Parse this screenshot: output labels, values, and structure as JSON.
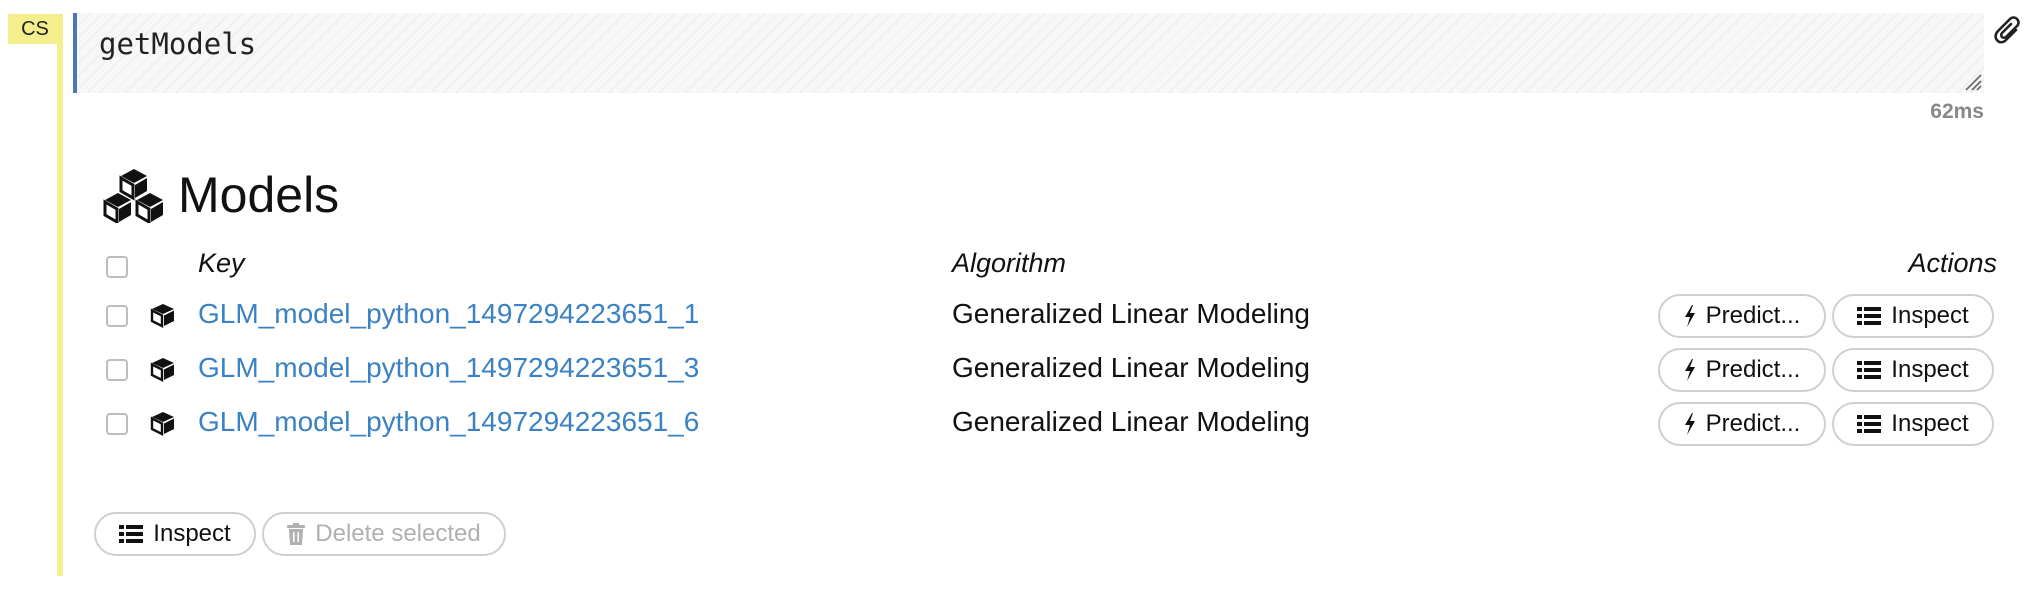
{
  "cell": {
    "type_tag": "CS",
    "code": "getModels",
    "elapsed": "62ms"
  },
  "models": {
    "title": "Models",
    "columns": {
      "key": "Key",
      "algorithm": "Algorithm",
      "actions": "Actions"
    },
    "rows": [
      {
        "key": "GLM_model_python_1497294223651_1",
        "algorithm": "Generalized Linear Modeling",
        "predict_label": "Predict...",
        "inspect_label": "Inspect"
      },
      {
        "key": "GLM_model_python_1497294223651_3",
        "algorithm": "Generalized Linear Modeling",
        "predict_label": "Predict...",
        "inspect_label": "Inspect"
      },
      {
        "key": "GLM_model_python_1497294223651_6",
        "algorithm": "Generalized Linear Modeling",
        "predict_label": "Predict...",
        "inspect_label": "Inspect"
      }
    ],
    "footer": {
      "inspect_label": "Inspect",
      "delete_label": "Delete selected"
    }
  },
  "colors": {
    "cell_tag_bg": "#f4ee8c",
    "editor_border": "#4a76b8",
    "link": "#3b82c4"
  },
  "icons": {
    "heading": "cubes-icon",
    "row": "cube-icon",
    "predict": "bolt-icon",
    "inspect": "list-icon",
    "delete": "trash-icon",
    "cell_action": "paperclip-icon"
  }
}
